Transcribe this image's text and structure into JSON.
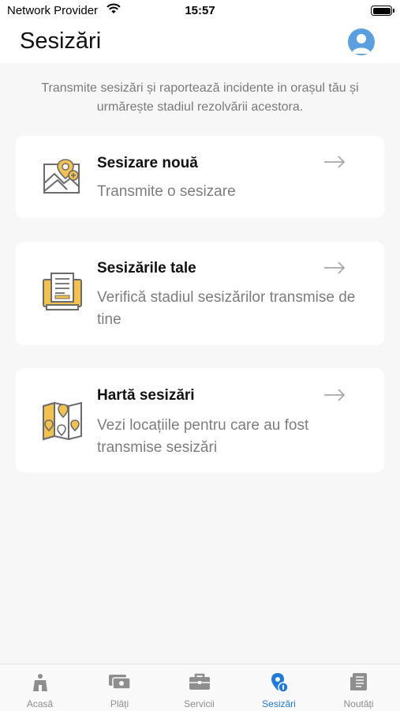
{
  "status_bar": {
    "carrier": "Network Provider",
    "time": "15:57"
  },
  "header": {
    "title": "Sesizări"
  },
  "intro": "Transmite sesizări și raportează incidente in orașul tău și urmărește stadiul rezolvării acestora.",
  "cards": [
    {
      "title": "Sesizare nouă",
      "description": "Transmite o sesizare",
      "icon": "map-pin-icon"
    },
    {
      "title": "Sesizările tale",
      "description": "Verifică stadiul sesizărilor transmise de tine",
      "icon": "documents-icon"
    },
    {
      "title": "Hartă sesizări",
      "description": "Vezi locațiile pentru care au fost transmise sesizări",
      "icon": "map-icon"
    }
  ],
  "tabs": [
    {
      "label": "Acasă",
      "icon": "home-icon"
    },
    {
      "label": "Plăți",
      "icon": "payments-icon"
    },
    {
      "label": "Servicii",
      "icon": "briefcase-icon"
    },
    {
      "label": "Sesizări",
      "icon": "report-pin-icon",
      "active": true
    },
    {
      "label": "Noutăți",
      "icon": "news-icon"
    }
  ],
  "colors": {
    "accent": "#1f7ae0",
    "icon_gold": "#f2c14e",
    "avatar": "#5aa0e0"
  }
}
